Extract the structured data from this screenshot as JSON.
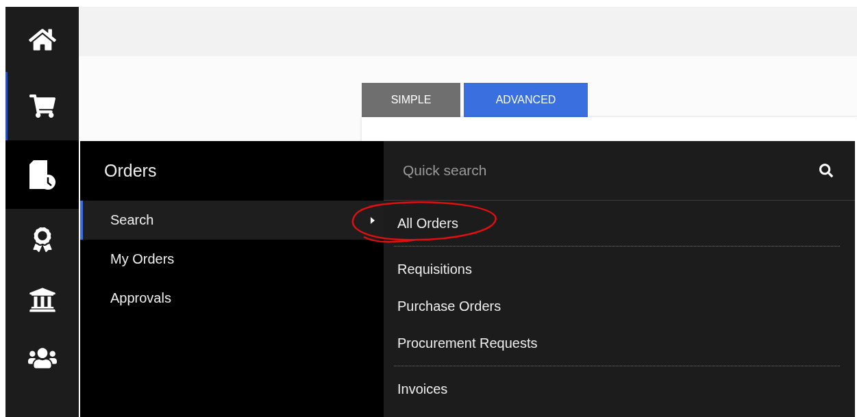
{
  "rail": [
    {
      "kind": "home",
      "selected": false,
      "expanded": false
    },
    {
      "kind": "cart",
      "selected": true,
      "expanded": false
    },
    {
      "kind": "orders",
      "selected": false,
      "expanded": true
    },
    {
      "kind": "award",
      "selected": false,
      "expanded": false
    },
    {
      "kind": "bank",
      "selected": false,
      "expanded": false
    },
    {
      "kind": "users",
      "selected": false,
      "expanded": false
    }
  ],
  "tabs": [
    {
      "label": "SIMPLE",
      "selected": false
    },
    {
      "label": "ADVANCED",
      "selected": true
    }
  ],
  "flyout": {
    "title": "Orders",
    "menu": [
      {
        "label": "Search",
        "selected": true
      },
      {
        "label": "My Orders",
        "selected": false
      },
      {
        "label": "Approvals",
        "selected": false
      }
    ],
    "search": {
      "placeholder": "Quick search"
    },
    "groups": [
      [
        "All Orders"
      ],
      [
        "Requisitions",
        "Purchase Orders",
        "Procurement Requests"
      ],
      [
        "Invoices"
      ]
    ]
  }
}
